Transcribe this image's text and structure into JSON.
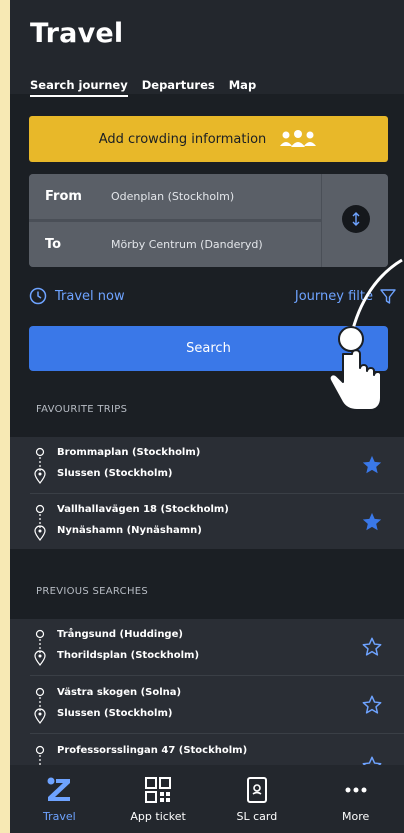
{
  "header": {
    "title": "Travel",
    "tabs": [
      {
        "label": "Search journey",
        "active": true
      },
      {
        "label": "Departures",
        "active": false
      },
      {
        "label": "Map",
        "active": false
      }
    ]
  },
  "crowding": {
    "label": "Add crowding information",
    "icon": "people-icon"
  },
  "journey": {
    "from_label": "From",
    "from_value": "Odenplan (Stockholm)",
    "to_label": "To",
    "to_value": "Mörby Centrum (Danderyd)",
    "swap_icon": "swap-vertical-icon"
  },
  "options": {
    "travel_now": "Travel now",
    "journey_filter": "Journey filte"
  },
  "search_label": "Search",
  "favourites": {
    "heading": "FAVOURITE TRIPS",
    "items": [
      {
        "from": "Brommaplan (Stockholm)",
        "to": "Slussen (Stockholm)"
      },
      {
        "from": "Vallhallavägen 18 (Stockholm)",
        "to": "Nynäshamn (Nynäshamn)"
      }
    ]
  },
  "previous": {
    "heading": "PREVIOUS SEARCHES",
    "items": [
      {
        "from": "Trångsund (Huddinge)",
        "to": "Thorildsplan (Stockholm)"
      },
      {
        "from": "Västra skogen (Solna)",
        "to": "Slussen (Stockholm)"
      },
      {
        "from": "Professorsslingan 47 (Stockholm)",
        "to": ""
      }
    ]
  },
  "bottom_nav": [
    {
      "label": "Travel",
      "icon": "travel-z-icon",
      "active": true
    },
    {
      "label": "App ticket",
      "icon": "qr-ticket-icon",
      "active": false
    },
    {
      "label": "SL card",
      "icon": "sl-card-icon",
      "active": false
    },
    {
      "label": "More",
      "icon": "more-dots-icon",
      "active": false
    }
  ],
  "colors": {
    "accent": "#3a78e8",
    "crowding": "#e8b829",
    "link": "#6ea3ff",
    "background": "#1b1f24"
  }
}
